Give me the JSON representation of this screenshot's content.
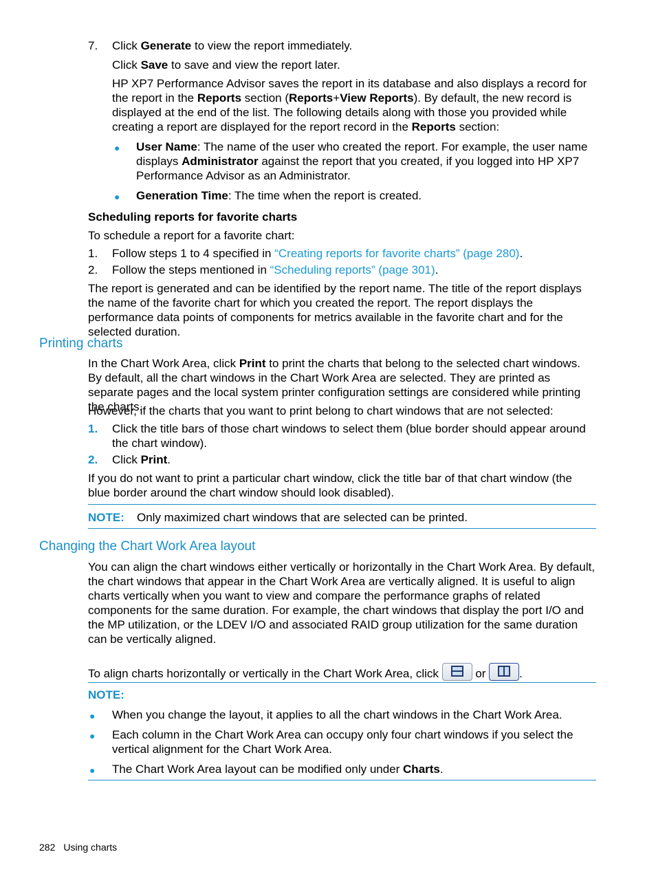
{
  "step7": {
    "number": "7.",
    "line1_pre": "Click ",
    "line1_bold": "Generate",
    "line1_post": " to view the report immediately.",
    "line2_pre": "Click ",
    "line2_bold": "Save",
    "line2_post": " to save and view the report later.",
    "para_1": "HP XP7 Performance Advisor saves the report in its database and also displays a record for the report in the ",
    "para_b1": "Reports",
    "para_2": " section (",
    "para_b2": "Reports",
    "para_3": "+",
    "para_b3": "View Reports",
    "para_4": "). By default, the new record is displayed at the end of the list. The following details along with those you provided while creating a report are displayed for the report record in the ",
    "para_b4": "Reports",
    "para_5": " section:",
    "bullets": [
      {
        "bold": "User Name",
        "text_1": ": The name of the user who created the report. For example, the user name displays ",
        "bold2": "Administrator",
        "text_2": " against the report that you created, if you logged into HP XP7 Performance Advisor as an Administrator."
      },
      {
        "bold": "Generation Time",
        "text_1": ": The time when the report is created."
      }
    ]
  },
  "scheduling": {
    "heading": "Scheduling reports for favorite charts",
    "intro": "To schedule a report for a favorite chart:",
    "steps": [
      {
        "number": "1.",
        "pre": "Follow steps 1 to 4 specified in ",
        "link": "“Creating reports for favorite charts” (page 280)",
        "post": "."
      },
      {
        "number": "2.",
        "pre": "Follow the steps mentioned in ",
        "link": "“Scheduling reports” (page 301)",
        "post": "."
      }
    ],
    "outro": "The report is generated and can be identified by the report name. The title of the report displays the name of the favorite chart for which you created the report. The report displays the performance data points of components for metrics available in the favorite chart and for the selected duration."
  },
  "printing": {
    "heading": "Printing charts",
    "para1_pre": "In the Chart Work Area, click ",
    "para1_bold": "Print",
    "para1_post": " to print the charts that belong to the selected chart windows. By default, all the chart windows in the Chart Work Area are selected. They are printed as separate pages and the local system printer configuration settings are considered while printing the charts.",
    "para2": "However, if the charts that you want to print belong to chart windows that are not selected:",
    "steps": [
      {
        "number": "1.",
        "text": "Click the title bars of those chart windows to select them (blue border should appear around the chart window)."
      },
      {
        "number": "2.",
        "pre": "Click ",
        "bold": "Print",
        "post": "."
      }
    ],
    "para3": "If you do not want to print a particular chart window, click the title bar of that chart window (the blue border around the chart window should look disabled).",
    "note_label": "NOTE:",
    "note_text": "Only maximized chart windows that are selected can be printed."
  },
  "layout": {
    "heading": "Changing the Chart Work Area layout",
    "para1": "You can align the chart windows either vertically or horizontally in the Chart Work Area. By default, the chart windows that appear in the Chart Work Area are vertically aligned. It is useful to align charts vertically when you want to view and compare the performance graphs of related components for the same duration. For example, the chart windows that display the port I/O and the MP utilization, or the LDEV I/O and associated RAID group utilization for the same duration can be vertically aligned.",
    "para2_pre": "To align charts horizontally or vertically in the Chart Work Area, click ",
    "para2_or": " or ",
    "para2_post": ".",
    "icons": [
      "horizontal-layout-icon",
      "vertical-layout-icon"
    ],
    "note_label": "NOTE:",
    "note_bullets": [
      {
        "text": "When you change the layout, it applies to all the chart windows in the Chart Work Area."
      },
      {
        "text": "Each column in the Chart Work Area can occupy only four chart windows if you select the vertical alignment for the Chart Work Area."
      },
      {
        "pre": "The Chart Work Area layout can be modified only under ",
        "bold": "Charts",
        "post": "."
      }
    ]
  },
  "footer": {
    "page_number": "282",
    "section": "Using charts"
  }
}
